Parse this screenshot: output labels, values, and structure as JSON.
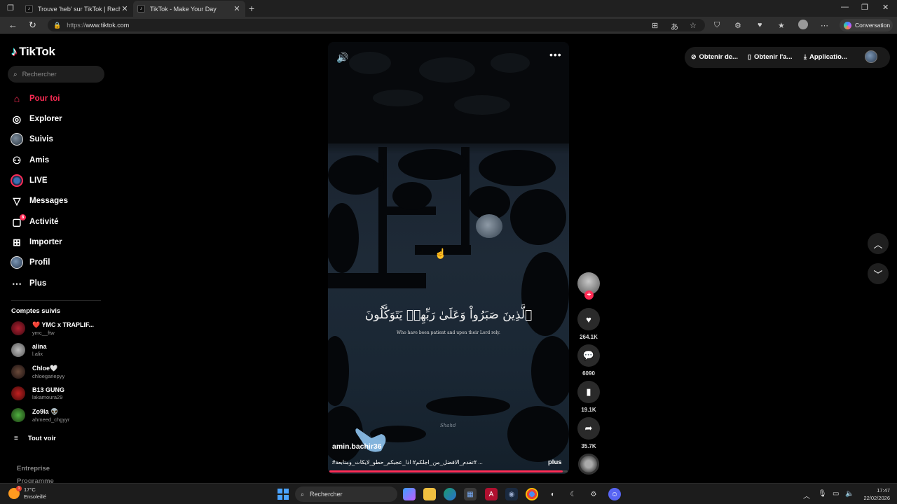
{
  "browser": {
    "tabs": [
      {
        "title": "Trouve 'heb' sur TikTok | Recherche"
      },
      {
        "title": "TikTok - Make Your Day"
      }
    ],
    "url_prefix": "https://",
    "url_host": "www.tiktok.com",
    "conversation_label": "Conversation"
  },
  "sidebar": {
    "brand": "TikTok",
    "search_placeholder": "Rechercher",
    "nav": [
      {
        "label": "Pour toi",
        "icon": "home-icon"
      },
      {
        "label": "Explorer",
        "icon": "compass-icon"
      },
      {
        "label": "Suivis",
        "icon": "following-avatar-icon"
      },
      {
        "label": "Amis",
        "icon": "friends-icon"
      },
      {
        "label": "LIVE",
        "icon": "live-icon"
      },
      {
        "label": "Messages",
        "icon": "send-icon"
      },
      {
        "label": "Activité",
        "icon": "activity-icon",
        "badge": "8"
      },
      {
        "label": "Importer",
        "icon": "upload-icon"
      },
      {
        "label": "Profil",
        "icon": "profile-avatar-icon"
      },
      {
        "label": "Plus",
        "icon": "more-icon"
      }
    ],
    "following_title": "Comptes suivis",
    "accounts": [
      {
        "name": "❤️ YMC x TRAPLIF...",
        "handle": "ymc__ftw",
        "color": "#7a1020"
      },
      {
        "name": "alina",
        "handle": "l.alix",
        "color": "#8a8a8a"
      },
      {
        "name": "Chloe🤍",
        "handle": "chloegariepyy",
        "color": "#3a2a22"
      },
      {
        "name": "B13 GUNG",
        "handle": "lakamoura29",
        "color": "#8a1a1a"
      },
      {
        "name": "Zo9la 👽",
        "handle": "ahmeed_chgyyr",
        "color": "#3a8a30"
      }
    ],
    "see_all": "Tout voir",
    "footer": [
      "Entreprise",
      "Programme"
    ]
  },
  "video": {
    "arabic_text": "ٱلَّذِينَ صَبَرُواْ وَعَلَىٰ رَبِّهِمۡ يَتَوَكَّلُونَ",
    "english_text": "Who have been patient and upon their Lord rely.",
    "watermark": "Shahd",
    "author": "amin.bachir36",
    "caption": "#تقدم_الافضل_من_اجلكم# اذا_عجبكم_حطو_لايكات_ومتابعة# ...",
    "more_label": "plus",
    "progress": 0.98
  },
  "actions": {
    "likes": "264.1K",
    "comments": "6090",
    "saves": "19.1K",
    "shares": "35.7K"
  },
  "top_actions": {
    "coins": "Obtenir de...",
    "app": "Obtenir l'a...",
    "desktop": "Applicatio..."
  },
  "taskbar": {
    "temperature": "17°C",
    "weather": "Ensoleillé",
    "search_label": "Rechercher",
    "time": "17:47",
    "date": "22/02/2026"
  }
}
